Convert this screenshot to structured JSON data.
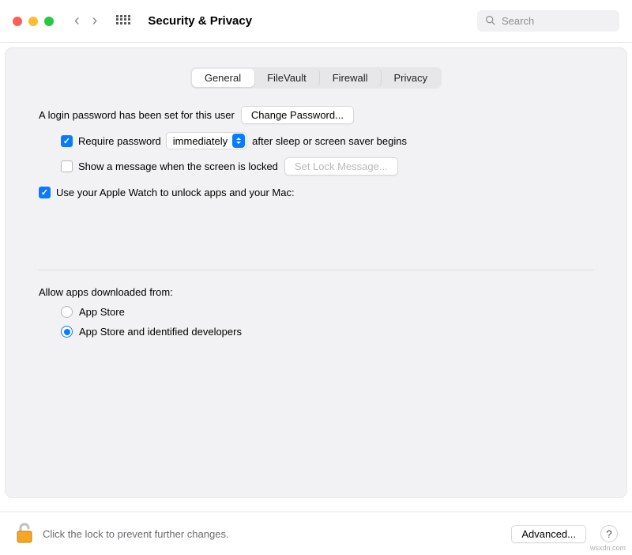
{
  "toolbar": {
    "title": "Security & Privacy",
    "search_placeholder": "Search"
  },
  "tabs": {
    "items": [
      "General",
      "FileVault",
      "Firewall",
      "Privacy"
    ],
    "active": "General"
  },
  "general": {
    "login_msg": "A login password has been set for this user",
    "change_password_btn": "Change Password...",
    "require_password_label": "Require password",
    "require_password_select": "immediately",
    "require_password_suffix": "after sleep or screen saver begins",
    "show_message_label": "Show a message when the screen is locked",
    "set_lock_msg_btn": "Set Lock Message...",
    "apple_watch_label": "Use your Apple Watch to unlock apps and your Mac:"
  },
  "downloads": {
    "heading": "Allow apps downloaded from:",
    "opt1": "App Store",
    "opt2": "App Store and identified developers"
  },
  "footer": {
    "lock_msg": "Click the lock to prevent further changes.",
    "advanced_btn": "Advanced...",
    "help": "?"
  },
  "watermark": "wsxdn.com"
}
